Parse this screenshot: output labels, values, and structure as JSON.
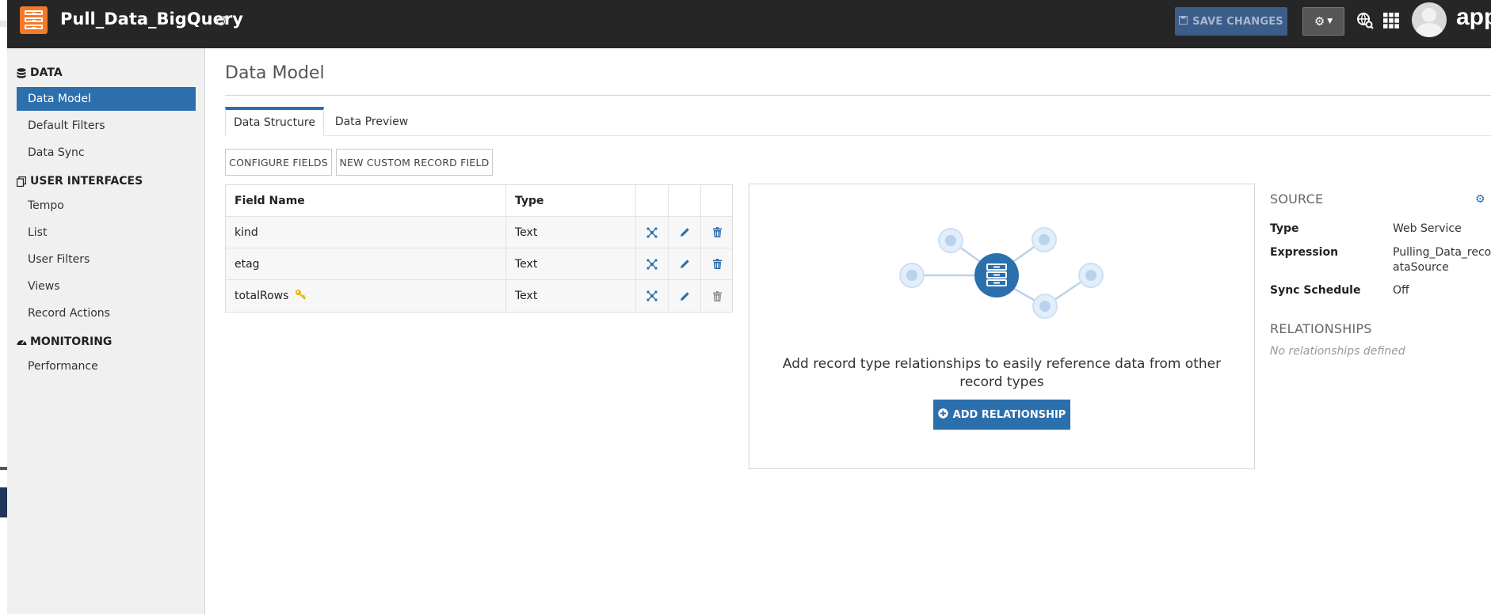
{
  "header": {
    "app_title": "Pull_Data_BigQuery",
    "save_label": "SAVE CHANGES",
    "brand_text": "app"
  },
  "sidebar": {
    "sections": [
      {
        "label": "DATA",
        "icon": "database-icon",
        "items": [
          "Data Model",
          "Default Filters",
          "Data Sync"
        ]
      },
      {
        "label": "USER INTERFACES",
        "icon": "copy-icon",
        "items": [
          "Tempo",
          "List",
          "User Filters",
          "Views",
          "Record Actions"
        ]
      },
      {
        "label": "MONITORING",
        "icon": "dashboard-icon",
        "items": [
          "Performance"
        ]
      }
    ],
    "active_item": "Data Model"
  },
  "main": {
    "title": "Data Model",
    "tabs": [
      "Data Structure",
      "Data Preview"
    ],
    "active_tab": "Data Structure",
    "buttons": [
      "CONFIGURE FIELDS",
      "NEW CUSTOM RECORD FIELD"
    ],
    "table": {
      "columns": [
        "Field Name",
        "Type"
      ],
      "rows": [
        {
          "name": "kind",
          "type": "Text",
          "primary_key": false
        },
        {
          "name": "etag",
          "type": "Text",
          "primary_key": false
        },
        {
          "name": "totalRows",
          "type": "Text",
          "primary_key": true
        }
      ]
    },
    "relationships_panel": {
      "message": "Add record type relationships to easily reference data from other record types",
      "button_label": "ADD RELATIONSHIP"
    }
  },
  "source": {
    "heading": "SOURCE",
    "type_label": "Type",
    "type_value": "Web Service",
    "expression_label": "Expression",
    "expression_value_line1": "Pulling_Data_recor",
    "expression_value_line2": "ataSource",
    "sync_label": "Sync Schedule",
    "sync_value": "Off"
  },
  "relationships": {
    "heading": "RELATIONSHIPS",
    "empty_text": "No relationships defined"
  },
  "colors": {
    "topbar": "#262626",
    "accent": "#2c6fad",
    "app_logo": "#f4792b",
    "save_button": "#3b5d8a"
  }
}
